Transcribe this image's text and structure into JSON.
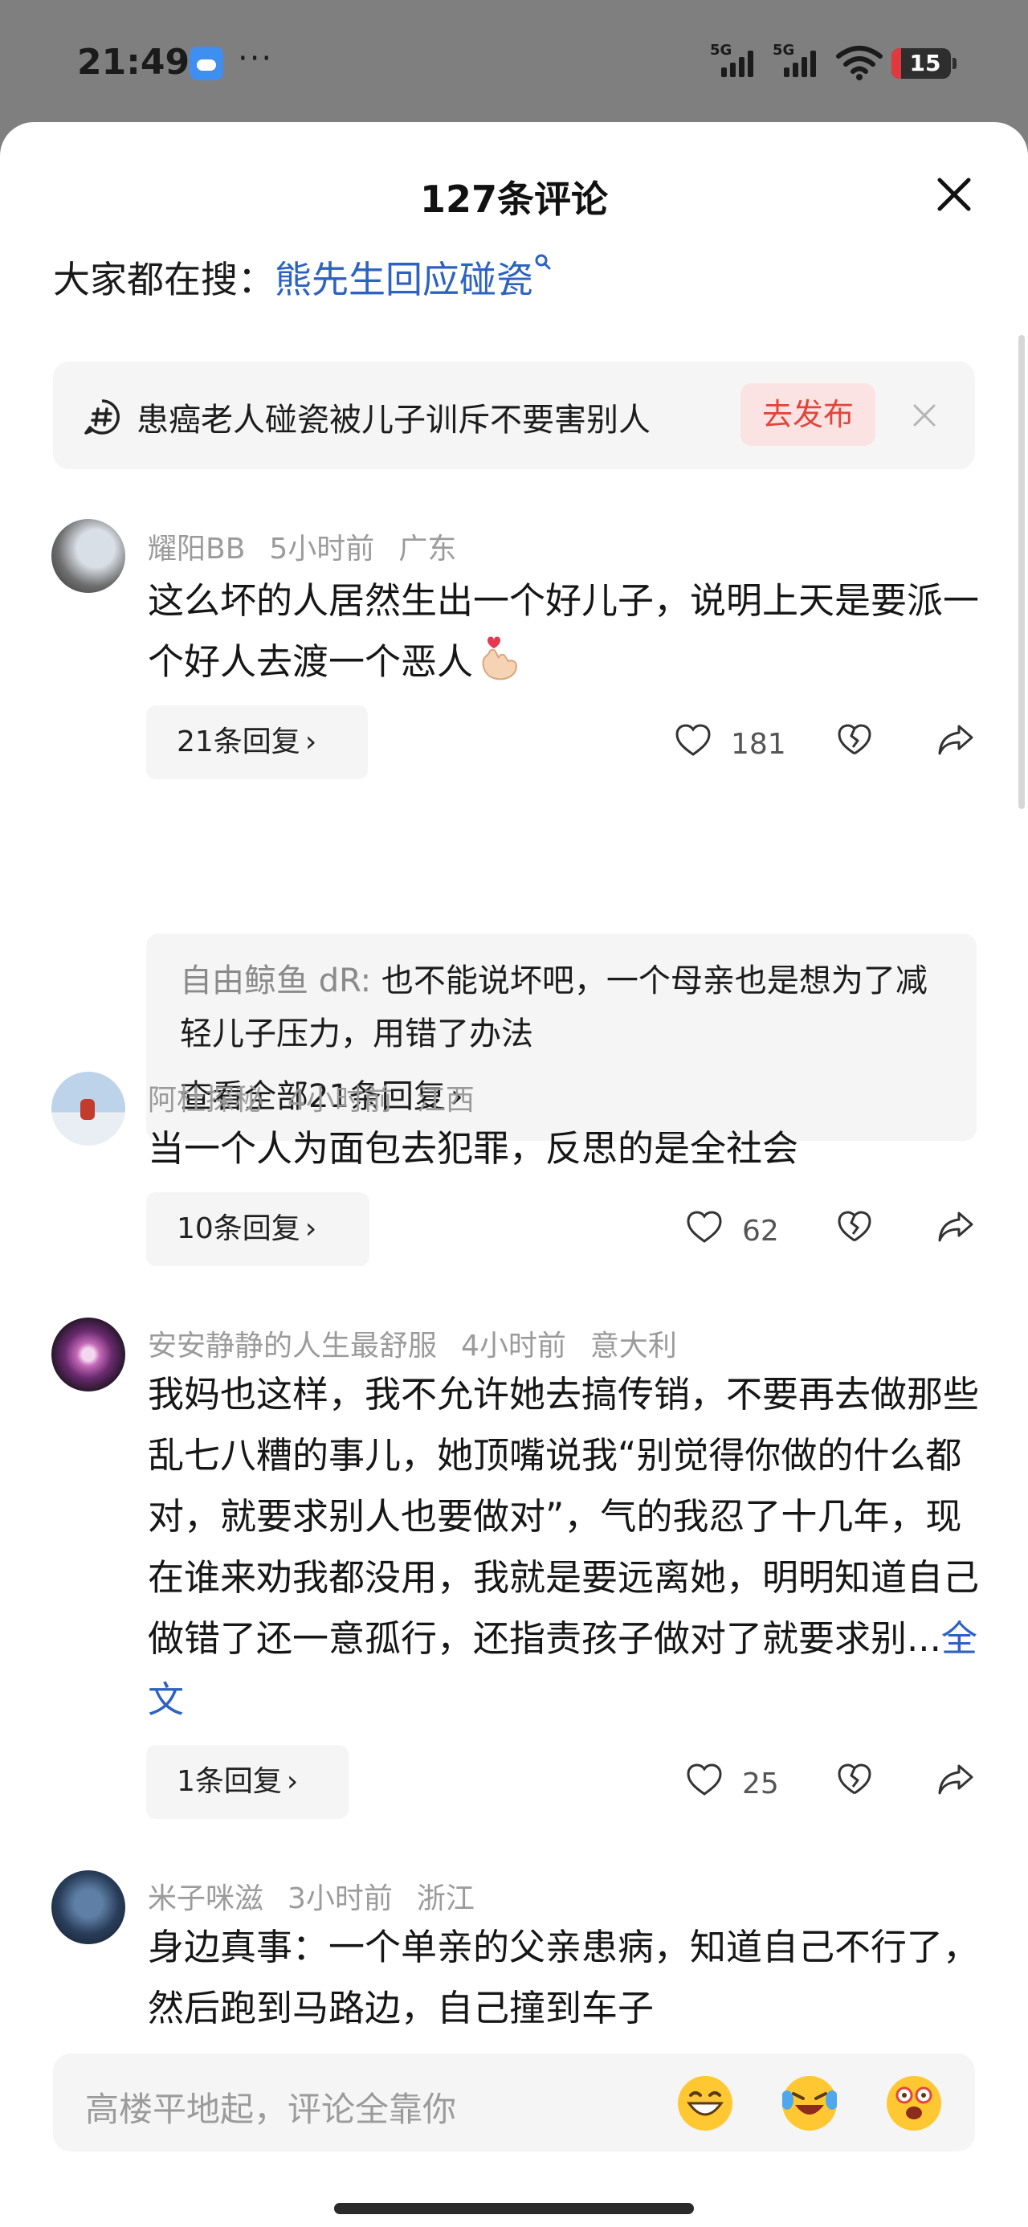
{
  "status_bar": {
    "time": "21:49",
    "more": "···",
    "signal_1": "5G",
    "signal_2": "5G",
    "battery": "15",
    "icons": [
      "weather-icon",
      "signal-icon",
      "wifi-icon",
      "battery-icon"
    ]
  },
  "sheet": {
    "title": "127条评论",
    "close_icon": "close-icon"
  },
  "hot_search": {
    "label": "大家都在搜：",
    "query": "熊先生回应碰瓷"
  },
  "topic": {
    "text": "患癌老人碰瓷被儿子训斥不要害别人",
    "publish_label": "去发布"
  },
  "comments": [
    {
      "user": "耀阳BB",
      "time": "5小时前",
      "location": "广东",
      "text": "这么坏的人居然生出一个好儿子，说明上天是要派一个好人去渡一个恶人",
      "replies_label": "21条回复",
      "likes": "181",
      "reply_preview": {
        "name": "自由鲸鱼 dR:",
        "text": " 也不能说坏吧，一个母亲也是想为了减轻儿子压力，用错了办法",
        "view_all": "查看全部21条回复"
      }
    },
    {
      "user": "阿杜探秘",
      "time": "4小时前",
      "location": "江西",
      "text": "当一个人为面包去犯罪，反思的是全社会",
      "replies_label": "10条回复",
      "likes": "62"
    },
    {
      "user": "安安静静的人生最舒服",
      "time": "4小时前",
      "location": "意大利",
      "text": "我妈也这样，我不允许她去搞传销，不要再去做那些乱七八糟的事儿，她顶嘴说我“别觉得你做的什么都对，就要求别人也要做对”，气的我忍了十几年，现在谁来劝我都没用，我就是要远离她，明明知道自己做错了还一意孤行，还指责孩子做对了就要求别...",
      "more_label": "全文",
      "replies_label": "1条回复",
      "likes": "25"
    },
    {
      "user": "米子咪滋",
      "time": "3小时前",
      "location": "浙江",
      "text": "身边真事：一个单亲的父亲患病，知道自己不行了，然后跑到马路边，自己撞到车子"
    }
  ],
  "input": {
    "placeholder": "高楼平地起，评论全靠你",
    "emojis": [
      "grin-emoji",
      "laugh-cry-emoji",
      "starstruck-emoji"
    ]
  },
  "colors": {
    "link": "#2d62c0",
    "publish_text": "#e2453c",
    "publish_bg": "#fbe3e3",
    "card_bg": "#f5f5f5",
    "meta_text": "#9b9b9b"
  }
}
